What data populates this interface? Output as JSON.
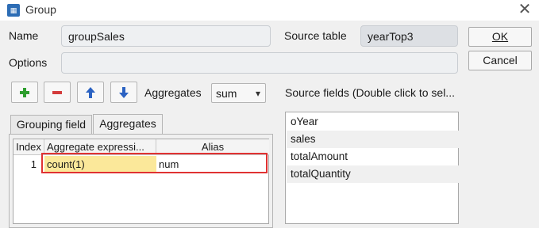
{
  "window": {
    "title": "Group"
  },
  "form": {
    "name_label": "Name",
    "name_value": "groupSales",
    "source_table_label": "Source table",
    "source_table_value": "yearTop3",
    "options_label": "Options",
    "options_value": ""
  },
  "buttons": {
    "ok_label": "OK",
    "cancel_label": "Cancel"
  },
  "toolbar": {
    "aggregates_label": "Aggregates",
    "aggregates_selected": "sum",
    "source_fields_label": "Source fields (Double click to sel..."
  },
  "tabs": [
    {
      "label": "Grouping field",
      "active": false
    },
    {
      "label": "Aggregates",
      "active": true
    }
  ],
  "table": {
    "columns": [
      "Index",
      "Aggregate expressi...",
      "Alias"
    ],
    "rows": [
      {
        "index": "1",
        "expression": "count(1)",
        "alias": "num"
      }
    ]
  },
  "source_fields": [
    "oYear",
    "sales",
    "totalAmount",
    "totalQuantity"
  ],
  "colors": {
    "selected_cell": "#fbe89a",
    "highlight_border": "#e03232",
    "plus_icon": "#2e9e2e",
    "minus_icon": "#d33b3b",
    "arrow_icon": "#2b62c2"
  },
  "icons": [
    "app-icon",
    "close-icon",
    "plus-icon",
    "minus-icon",
    "arrow-up-icon",
    "arrow-down-icon",
    "chevron-down-icon"
  ]
}
